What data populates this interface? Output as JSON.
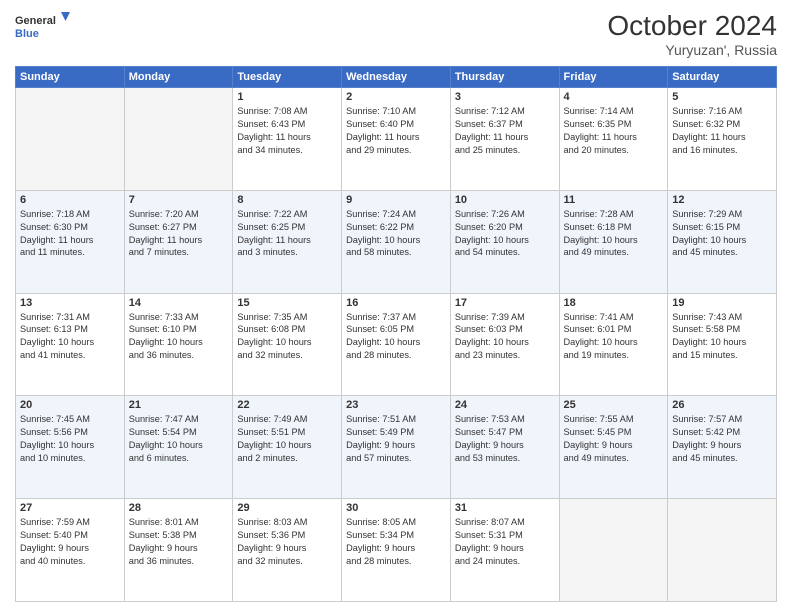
{
  "logo": {
    "line1": "General",
    "line2": "Blue"
  },
  "title": "October 2024",
  "subtitle": "Yuryuzan', Russia",
  "days_header": [
    "Sunday",
    "Monday",
    "Tuesday",
    "Wednesday",
    "Thursday",
    "Friday",
    "Saturday"
  ],
  "weeks": [
    [
      {
        "day": "",
        "content": ""
      },
      {
        "day": "",
        "content": ""
      },
      {
        "day": "1",
        "content": "Sunrise: 7:08 AM\nSunset: 6:43 PM\nDaylight: 11 hours\nand 34 minutes."
      },
      {
        "day": "2",
        "content": "Sunrise: 7:10 AM\nSunset: 6:40 PM\nDaylight: 11 hours\nand 29 minutes."
      },
      {
        "day": "3",
        "content": "Sunrise: 7:12 AM\nSunset: 6:37 PM\nDaylight: 11 hours\nand 25 minutes."
      },
      {
        "day": "4",
        "content": "Sunrise: 7:14 AM\nSunset: 6:35 PM\nDaylight: 11 hours\nand 20 minutes."
      },
      {
        "day": "5",
        "content": "Sunrise: 7:16 AM\nSunset: 6:32 PM\nDaylight: 11 hours\nand 16 minutes."
      }
    ],
    [
      {
        "day": "6",
        "content": "Sunrise: 7:18 AM\nSunset: 6:30 PM\nDaylight: 11 hours\nand 11 minutes."
      },
      {
        "day": "7",
        "content": "Sunrise: 7:20 AM\nSunset: 6:27 PM\nDaylight: 11 hours\nand 7 minutes."
      },
      {
        "day": "8",
        "content": "Sunrise: 7:22 AM\nSunset: 6:25 PM\nDaylight: 11 hours\nand 3 minutes."
      },
      {
        "day": "9",
        "content": "Sunrise: 7:24 AM\nSunset: 6:22 PM\nDaylight: 10 hours\nand 58 minutes."
      },
      {
        "day": "10",
        "content": "Sunrise: 7:26 AM\nSunset: 6:20 PM\nDaylight: 10 hours\nand 54 minutes."
      },
      {
        "day": "11",
        "content": "Sunrise: 7:28 AM\nSunset: 6:18 PM\nDaylight: 10 hours\nand 49 minutes."
      },
      {
        "day": "12",
        "content": "Sunrise: 7:29 AM\nSunset: 6:15 PM\nDaylight: 10 hours\nand 45 minutes."
      }
    ],
    [
      {
        "day": "13",
        "content": "Sunrise: 7:31 AM\nSunset: 6:13 PM\nDaylight: 10 hours\nand 41 minutes."
      },
      {
        "day": "14",
        "content": "Sunrise: 7:33 AM\nSunset: 6:10 PM\nDaylight: 10 hours\nand 36 minutes."
      },
      {
        "day": "15",
        "content": "Sunrise: 7:35 AM\nSunset: 6:08 PM\nDaylight: 10 hours\nand 32 minutes."
      },
      {
        "day": "16",
        "content": "Sunrise: 7:37 AM\nSunset: 6:05 PM\nDaylight: 10 hours\nand 28 minutes."
      },
      {
        "day": "17",
        "content": "Sunrise: 7:39 AM\nSunset: 6:03 PM\nDaylight: 10 hours\nand 23 minutes."
      },
      {
        "day": "18",
        "content": "Sunrise: 7:41 AM\nSunset: 6:01 PM\nDaylight: 10 hours\nand 19 minutes."
      },
      {
        "day": "19",
        "content": "Sunrise: 7:43 AM\nSunset: 5:58 PM\nDaylight: 10 hours\nand 15 minutes."
      }
    ],
    [
      {
        "day": "20",
        "content": "Sunrise: 7:45 AM\nSunset: 5:56 PM\nDaylight: 10 hours\nand 10 minutes."
      },
      {
        "day": "21",
        "content": "Sunrise: 7:47 AM\nSunset: 5:54 PM\nDaylight: 10 hours\nand 6 minutes."
      },
      {
        "day": "22",
        "content": "Sunrise: 7:49 AM\nSunset: 5:51 PM\nDaylight: 10 hours\nand 2 minutes."
      },
      {
        "day": "23",
        "content": "Sunrise: 7:51 AM\nSunset: 5:49 PM\nDaylight: 9 hours\nand 57 minutes."
      },
      {
        "day": "24",
        "content": "Sunrise: 7:53 AM\nSunset: 5:47 PM\nDaylight: 9 hours\nand 53 minutes."
      },
      {
        "day": "25",
        "content": "Sunrise: 7:55 AM\nSunset: 5:45 PM\nDaylight: 9 hours\nand 49 minutes."
      },
      {
        "day": "26",
        "content": "Sunrise: 7:57 AM\nSunset: 5:42 PM\nDaylight: 9 hours\nand 45 minutes."
      }
    ],
    [
      {
        "day": "27",
        "content": "Sunrise: 7:59 AM\nSunset: 5:40 PM\nDaylight: 9 hours\nand 40 minutes."
      },
      {
        "day": "28",
        "content": "Sunrise: 8:01 AM\nSunset: 5:38 PM\nDaylight: 9 hours\nand 36 minutes."
      },
      {
        "day": "29",
        "content": "Sunrise: 8:03 AM\nSunset: 5:36 PM\nDaylight: 9 hours\nand 32 minutes."
      },
      {
        "day": "30",
        "content": "Sunrise: 8:05 AM\nSunset: 5:34 PM\nDaylight: 9 hours\nand 28 minutes."
      },
      {
        "day": "31",
        "content": "Sunrise: 8:07 AM\nSunset: 5:31 PM\nDaylight: 9 hours\nand 24 minutes."
      },
      {
        "day": "",
        "content": ""
      },
      {
        "day": "",
        "content": ""
      }
    ]
  ]
}
